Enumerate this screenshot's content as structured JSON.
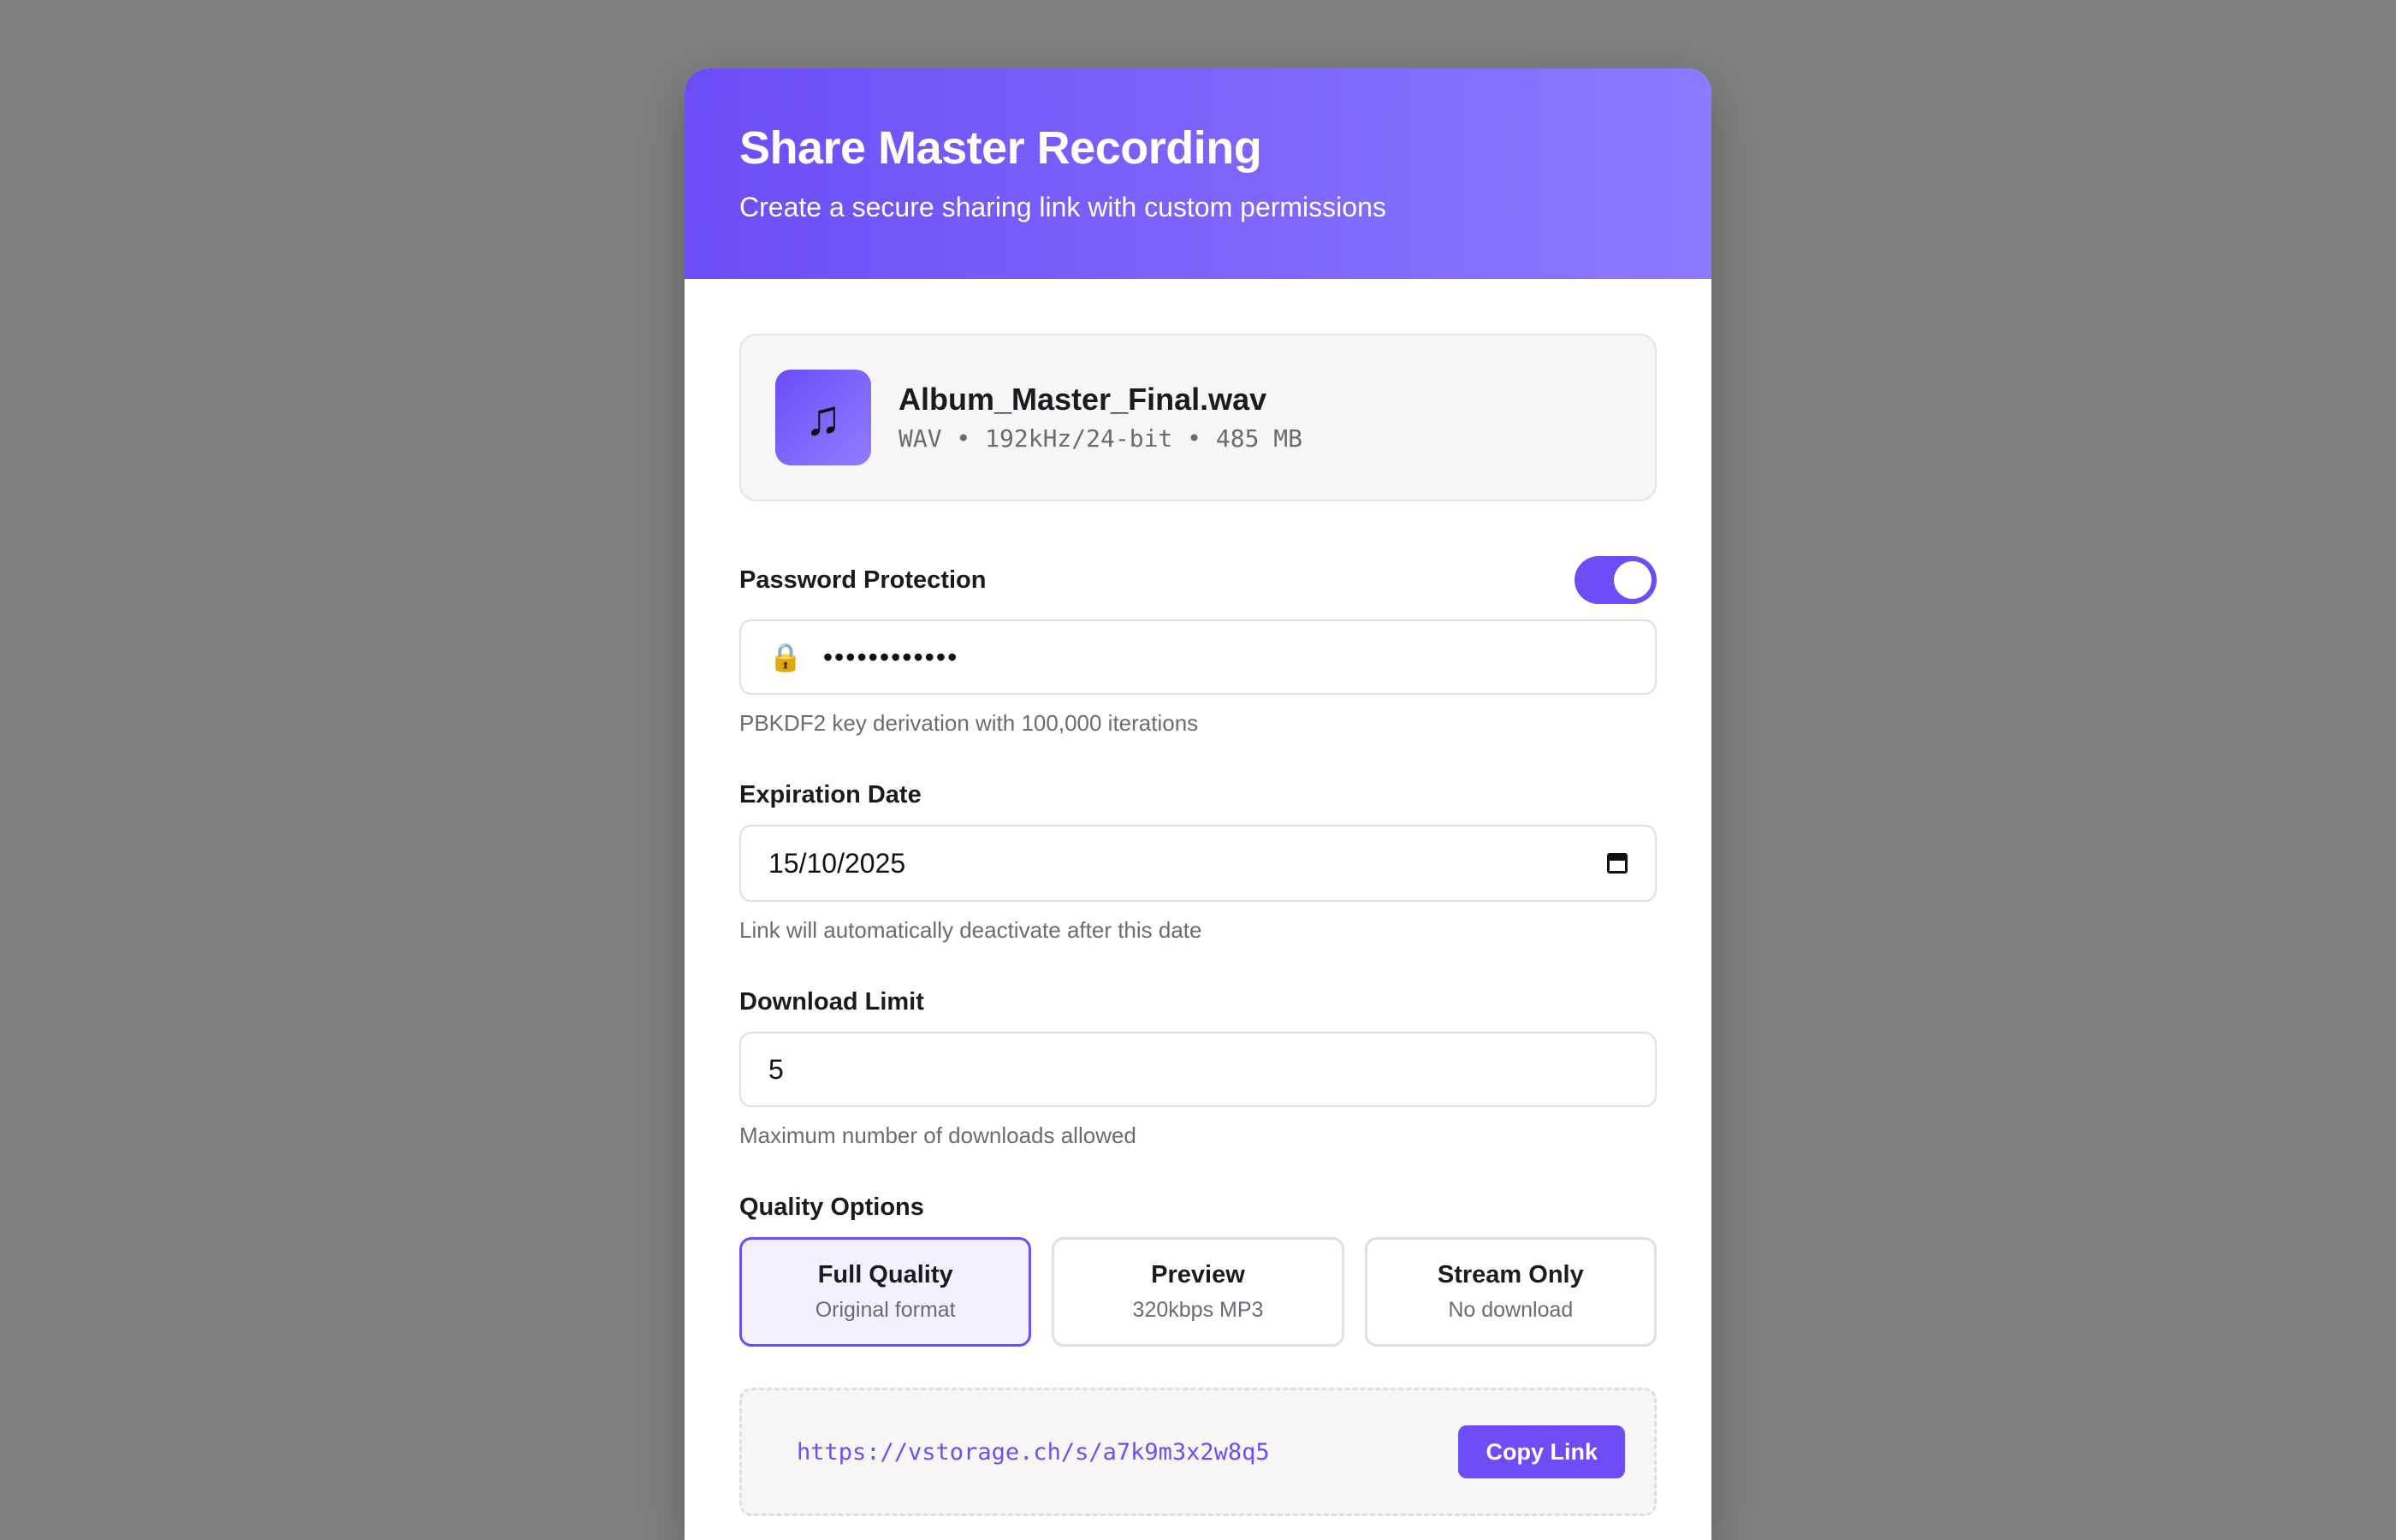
{
  "modal": {
    "title": "Share Master Recording",
    "subtitle": "Create a secure sharing link with custom permissions"
  },
  "file": {
    "icon": "music-note-icon",
    "name": "Album_Master_Final.wav",
    "meta": "WAV • 192kHz/24-bit • 485 MB"
  },
  "password": {
    "label": "Password Protection",
    "enabled": true,
    "masked_value": "••••••••••••",
    "hint": "PBKDF2 key derivation with 100,000 iterations",
    "icon": "lock-icon"
  },
  "expiration": {
    "label": "Expiration Date",
    "value": "15/10/2025",
    "hint": "Link will automatically deactivate after this date",
    "icon": "calendar-icon"
  },
  "download_limit": {
    "label": "Download Limit",
    "value": "5",
    "hint": "Maximum number of downloads allowed"
  },
  "quality": {
    "label": "Quality Options",
    "options": [
      {
        "title": "Full Quality",
        "subtitle": "Original format",
        "selected": true
      },
      {
        "title": "Preview",
        "subtitle": "320kbps MP3",
        "selected": false
      },
      {
        "title": "Stream Only",
        "subtitle": "No download",
        "selected": false
      }
    ]
  },
  "share_link": {
    "url": "https://vstorage.ch/s/a7k9m3x2w8q5",
    "copy_label": "Copy Link"
  },
  "colors": {
    "accent": "#6c4df6",
    "accent_light": "#8a7bff",
    "backdrop": "#808080",
    "selected_bg": "#f3f1ff"
  }
}
